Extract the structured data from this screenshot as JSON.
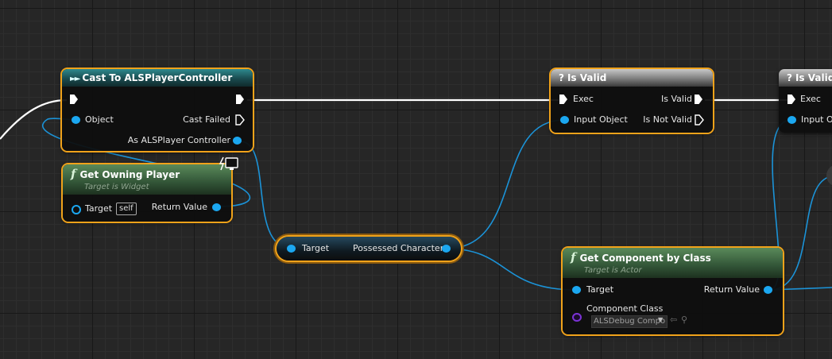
{
  "colors": {
    "selection_outline": "#f0a21a",
    "object_pin": "#1ba7f0",
    "class_pin": "#7b32d6",
    "exec_wire": "#ffffff"
  },
  "nodes": {
    "cast": {
      "icon": "cast-arrows-icon",
      "title": "Cast To ALSPlayerController",
      "object_label": "Object",
      "cast_failed_label": "Cast Failed",
      "as_label": "As ALSPlayer Controller"
    },
    "get_owning_player": {
      "icon": "function-icon",
      "badge_icon": "server-client-icon",
      "title": "Get Owning Player",
      "subtitle": "Target is Widget",
      "target_label": "Target",
      "target_default": "self",
      "return_label": "Return Value"
    },
    "possessed": {
      "target_label": "Target",
      "output_label": "Possessed Character"
    },
    "is_valid_1": {
      "icon": "question-icon",
      "title": "Is Valid",
      "exec_label": "Exec",
      "input_label": "Input Object",
      "is_valid_label": "Is Valid",
      "is_not_valid_label": "Is Not Valid"
    },
    "is_valid_2": {
      "icon": "question-icon",
      "title": "Is Valid",
      "exec_label": "Exec",
      "input_label": "Input Ob"
    },
    "get_component": {
      "icon": "function-icon",
      "title": "Get Component by Class",
      "subtitle": "Target is Actor",
      "target_label": "Target",
      "return_label": "Return Value",
      "class_label": "Component Class",
      "class_value": "ALSDebug Compo"
    }
  }
}
